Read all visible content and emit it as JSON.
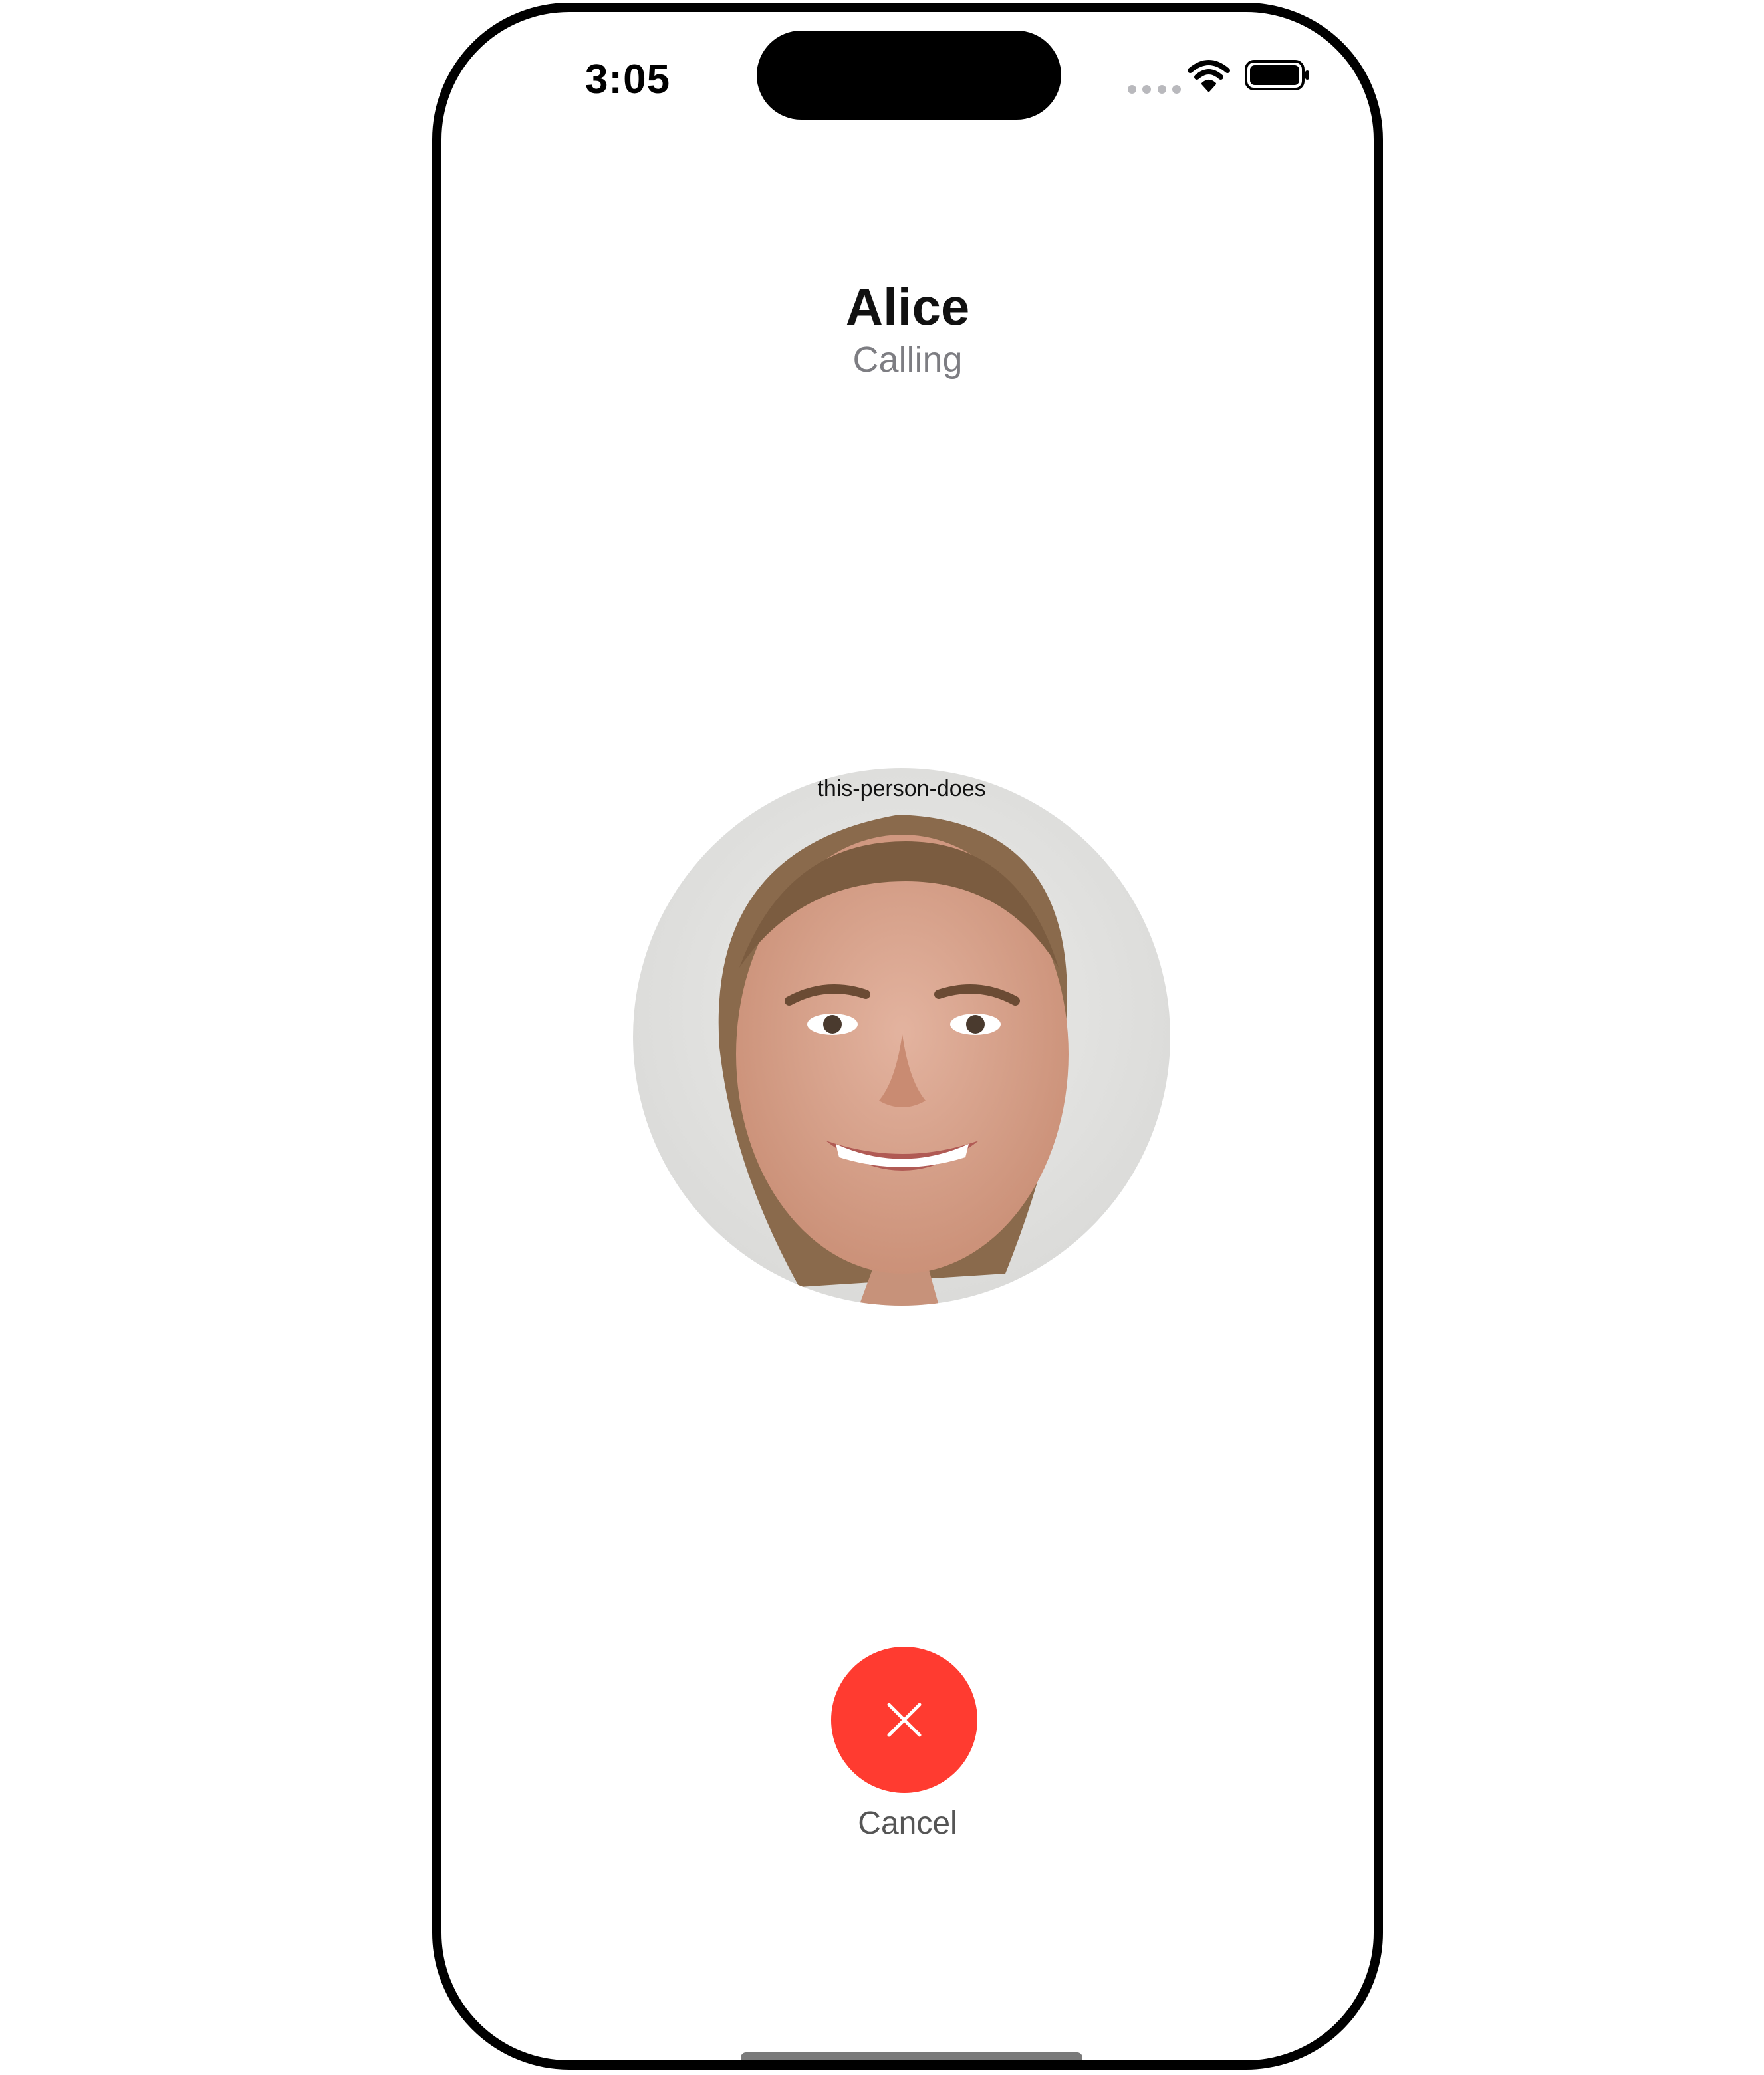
{
  "status_bar": {
    "time": "3:05",
    "icons": [
      "signal-dots-icon",
      "wifi-icon",
      "battery-icon"
    ]
  },
  "call": {
    "name": "Alice",
    "status": "Calling"
  },
  "avatar": {
    "alt_text": "this-person-does"
  },
  "cancel": {
    "label": "Cancel",
    "icon": "close-icon",
    "color": "#ff3b30"
  }
}
